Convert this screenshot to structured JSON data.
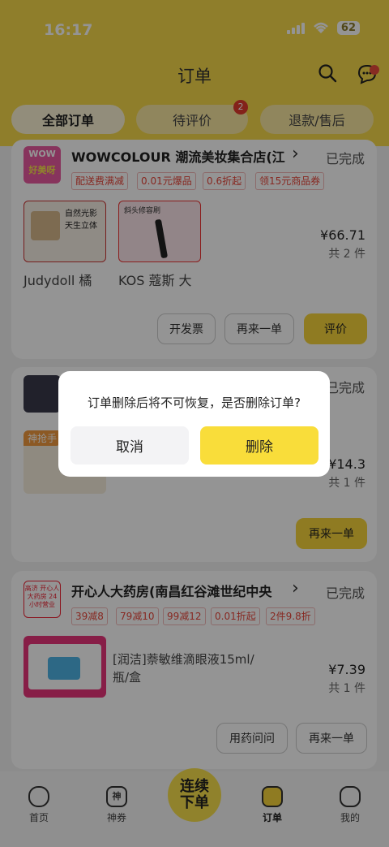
{
  "status_bar": {
    "time": "16:17",
    "battery": "62"
  },
  "header": {
    "title": "订单",
    "message_count": "8"
  },
  "tabs": [
    {
      "label": "全部订单"
    },
    {
      "label": "待评价",
      "badge": "2"
    },
    {
      "label": "退款/售后"
    }
  ],
  "orders": [
    {
      "shop": "WOWCOLOUR 潮流美妆集合店(江",
      "status": "已完成",
      "tags": [
        "配送费满减",
        "0.01元爆品",
        "0.6折起",
        "领15元商品券"
      ],
      "products": [
        {
          "name": "Judydoll 橘",
          "img_text": "自然光影 天生立体"
        },
        {
          "name": "KOS 蔻斯 大",
          "img_text": "斜头修容刷"
        }
      ],
      "price": "¥66.71",
      "qty": "共 2 件",
      "buttons": [
        "开发票",
        "再来一单",
        "评价"
      ]
    },
    {
      "shop": "",
      "status": "已完成",
      "tags": [],
      "promo": "神抢手",
      "price": "¥14.3",
      "qty": "共 1 件",
      "buttons": [
        "再来一单"
      ]
    },
    {
      "shop": "开心人大药房(南昌红谷滩世纪中央",
      "status": "已完成",
      "tags": [
        "39减8",
        "79减10",
        "99减12",
        "0.01折起",
        "2件9.8折"
      ],
      "logo_text": "高济 开心人大药房 24小时营业",
      "product_name_line1": "[润洁]萘敏维滴眼液15ml/",
      "product_name_line2": "瓶/盒",
      "price": "¥7.39",
      "qty": "共 1 件",
      "buttons": [
        "用药问问",
        "再来一单"
      ]
    }
  ],
  "dialog": {
    "message": "订单删除后将不可恢复，是否删除订单?",
    "cancel": "取消",
    "confirm": "删除"
  },
  "bottom_nav": {
    "items": [
      {
        "label": "首页",
        "icon": "home-icon"
      },
      {
        "label": "神券",
        "icon": "coupon-icon",
        "glyph": "神"
      },
      {
        "label": "订单",
        "icon": "order-icon"
      },
      {
        "label": "我的",
        "icon": "profile-icon"
      }
    ],
    "center_line1": "连续",
    "center_line2": "下单"
  },
  "colors": {
    "brand_yellow": "#f7d94a",
    "accent_red": "#e8473b",
    "button_yellow": "#f6d53b"
  }
}
